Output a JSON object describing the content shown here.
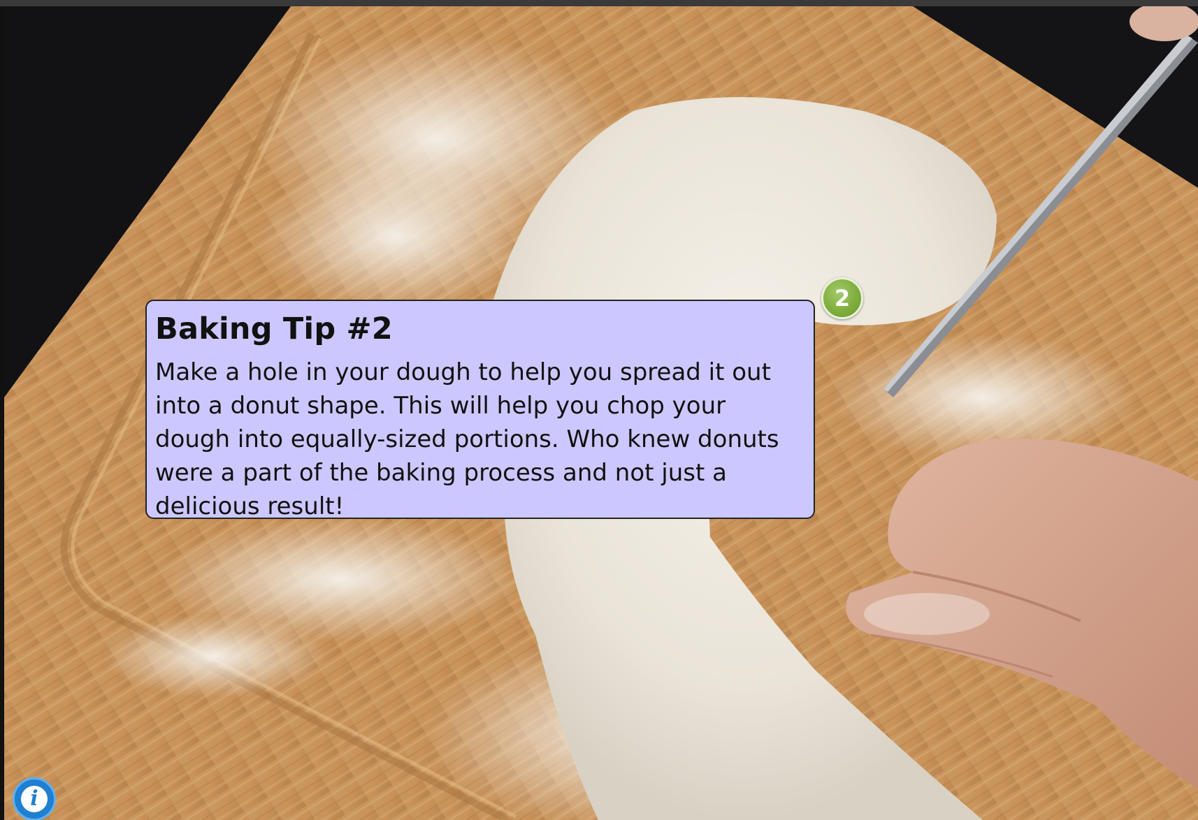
{
  "callout": {
    "title": "Baking Tip #2",
    "body": "Make a hole in your dough to help you spread it out into a donut shape. This will help you chop your dough into equally-sized portions. Who knew donuts were a part of the baking process and not just a delicious result!"
  },
  "marker": {
    "number": "2",
    "color": "#7fae3d"
  },
  "info_button": {
    "icon": "info-icon",
    "glyph": "i",
    "color": "#1f7fd1"
  },
  "colors": {
    "callout_background": "#ccc8ff",
    "board": "#c99a62",
    "dough": "#ece7df"
  }
}
